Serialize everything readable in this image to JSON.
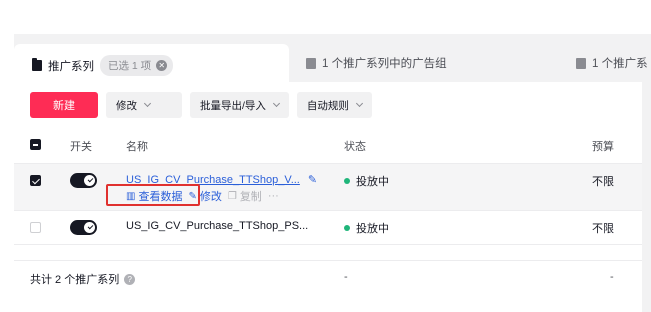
{
  "tabs": [
    {
      "label": "推广系列",
      "badge": "已选 1 项"
    },
    {
      "label": "1 个推广系列中的广告组"
    },
    {
      "label": "1 个推广系"
    }
  ],
  "toolbar": {
    "new_label": "新建",
    "edit_label": "修改",
    "bulk_label": "批量导出/导入",
    "rules_label": "自动规则"
  },
  "table": {
    "headers": {
      "toggle": "开关",
      "name": "名称",
      "status": "状态",
      "budget": "预算"
    },
    "rows": [
      {
        "name": "US_IG_CV_Purchase_TTShop_V...",
        "status": "投放中",
        "budget": "不限",
        "checked": true,
        "on": true
      },
      {
        "name": "US_IG_CV_Purchase_TTShop_PS...",
        "status": "投放中",
        "budget": "不限",
        "checked": false,
        "on": true
      }
    ],
    "row_actions": {
      "view": "查看数据",
      "edit": "修改",
      "copy": "复制",
      "more": "···"
    },
    "footer": {
      "total": "共计 2 个推广系列",
      "status_dash": "-",
      "budget_dash": "-"
    }
  },
  "colors": {
    "primary": "#fe2c55",
    "link": "#2b5fd9",
    "status_active": "#1fb57a",
    "highlight": "#e0312f"
  }
}
